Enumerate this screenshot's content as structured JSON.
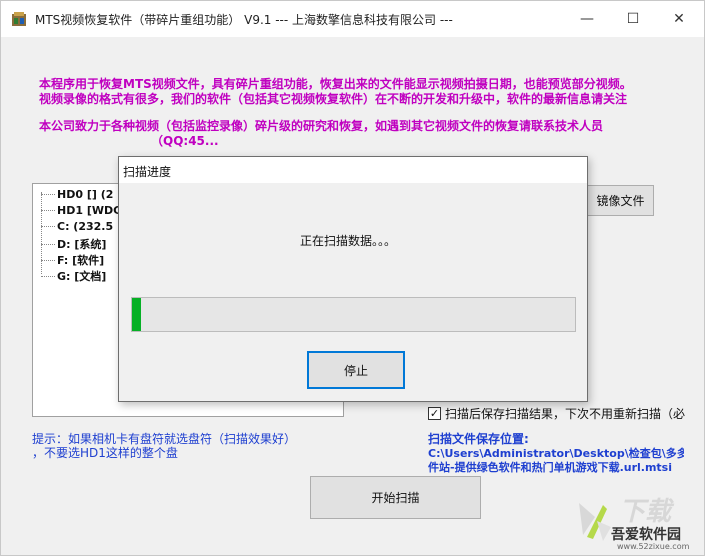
{
  "window": {
    "title": "MTS视频恢复软件（带碎片重组功能） V9.1 --- 上海数擎信息科技有限公司 ---",
    "controls": {
      "minimize": "—",
      "maximize": "☐",
      "close": "✕"
    }
  },
  "intro": {
    "line1": "本程序用于恢复MTS视频文件，具有碎片重组功能，恢复出来的文件能显示视频拍摄日期，也能预览部分视频。",
    "line2": "视频录像的格式有很多，我们的软件（包括其它视频恢复软件）在不断的开发和升级中，软件的最新信息请关注",
    "line3": "本公司致力于各种视频（包括监控录像）碎片级的研究和恢复，如遇到其它视频文件的恢复请联系技术人员",
    "line4_partial": "（QQ:45..."
  },
  "drive_tree": {
    "items": [
      {
        "label": "HD0   [] (2"
      },
      {
        "label": "HD1   [WDC"
      },
      {
        "label": "C:    (232.5"
      },
      {
        "label": "D:  [系统]"
      },
      {
        "label": "F:  [软件]"
      },
      {
        "label": "G:  [文档]"
      }
    ]
  },
  "buttons": {
    "image_file": "镜像文件",
    "start_scan": "开始扫描"
  },
  "save_option": {
    "checked": true,
    "label": "扫描后保存扫描结果，下次不用重新扫描（必"
  },
  "tips": {
    "line1": "提示：如果相机卡有盘符就选盘符（扫描效果好）",
    "line2": "，不要选HD1这样的整个盘"
  },
  "save_location": {
    "label": "扫描文件保存位置:",
    "path_line1": "C:\\Users\\Administrator\\Desktop\\检查包\\多多",
    "path_line2": "件站-提供绿色软件和热门单机游戏下载.url.mtsi"
  },
  "scan_dialog": {
    "title": "扫描进度",
    "message": "正在扫描数据。。。",
    "progress": 0.005,
    "stop_button": "停止"
  },
  "watermark": {
    "big": "下载",
    "name": "吾爱软件园",
    "url": "www.52zixue.com"
  },
  "colors": {
    "intro_text": "#c000c0",
    "tip_text": "#1e3fd0",
    "progress_fill": "#06b025",
    "dialog_button_border": "#0078d7"
  }
}
